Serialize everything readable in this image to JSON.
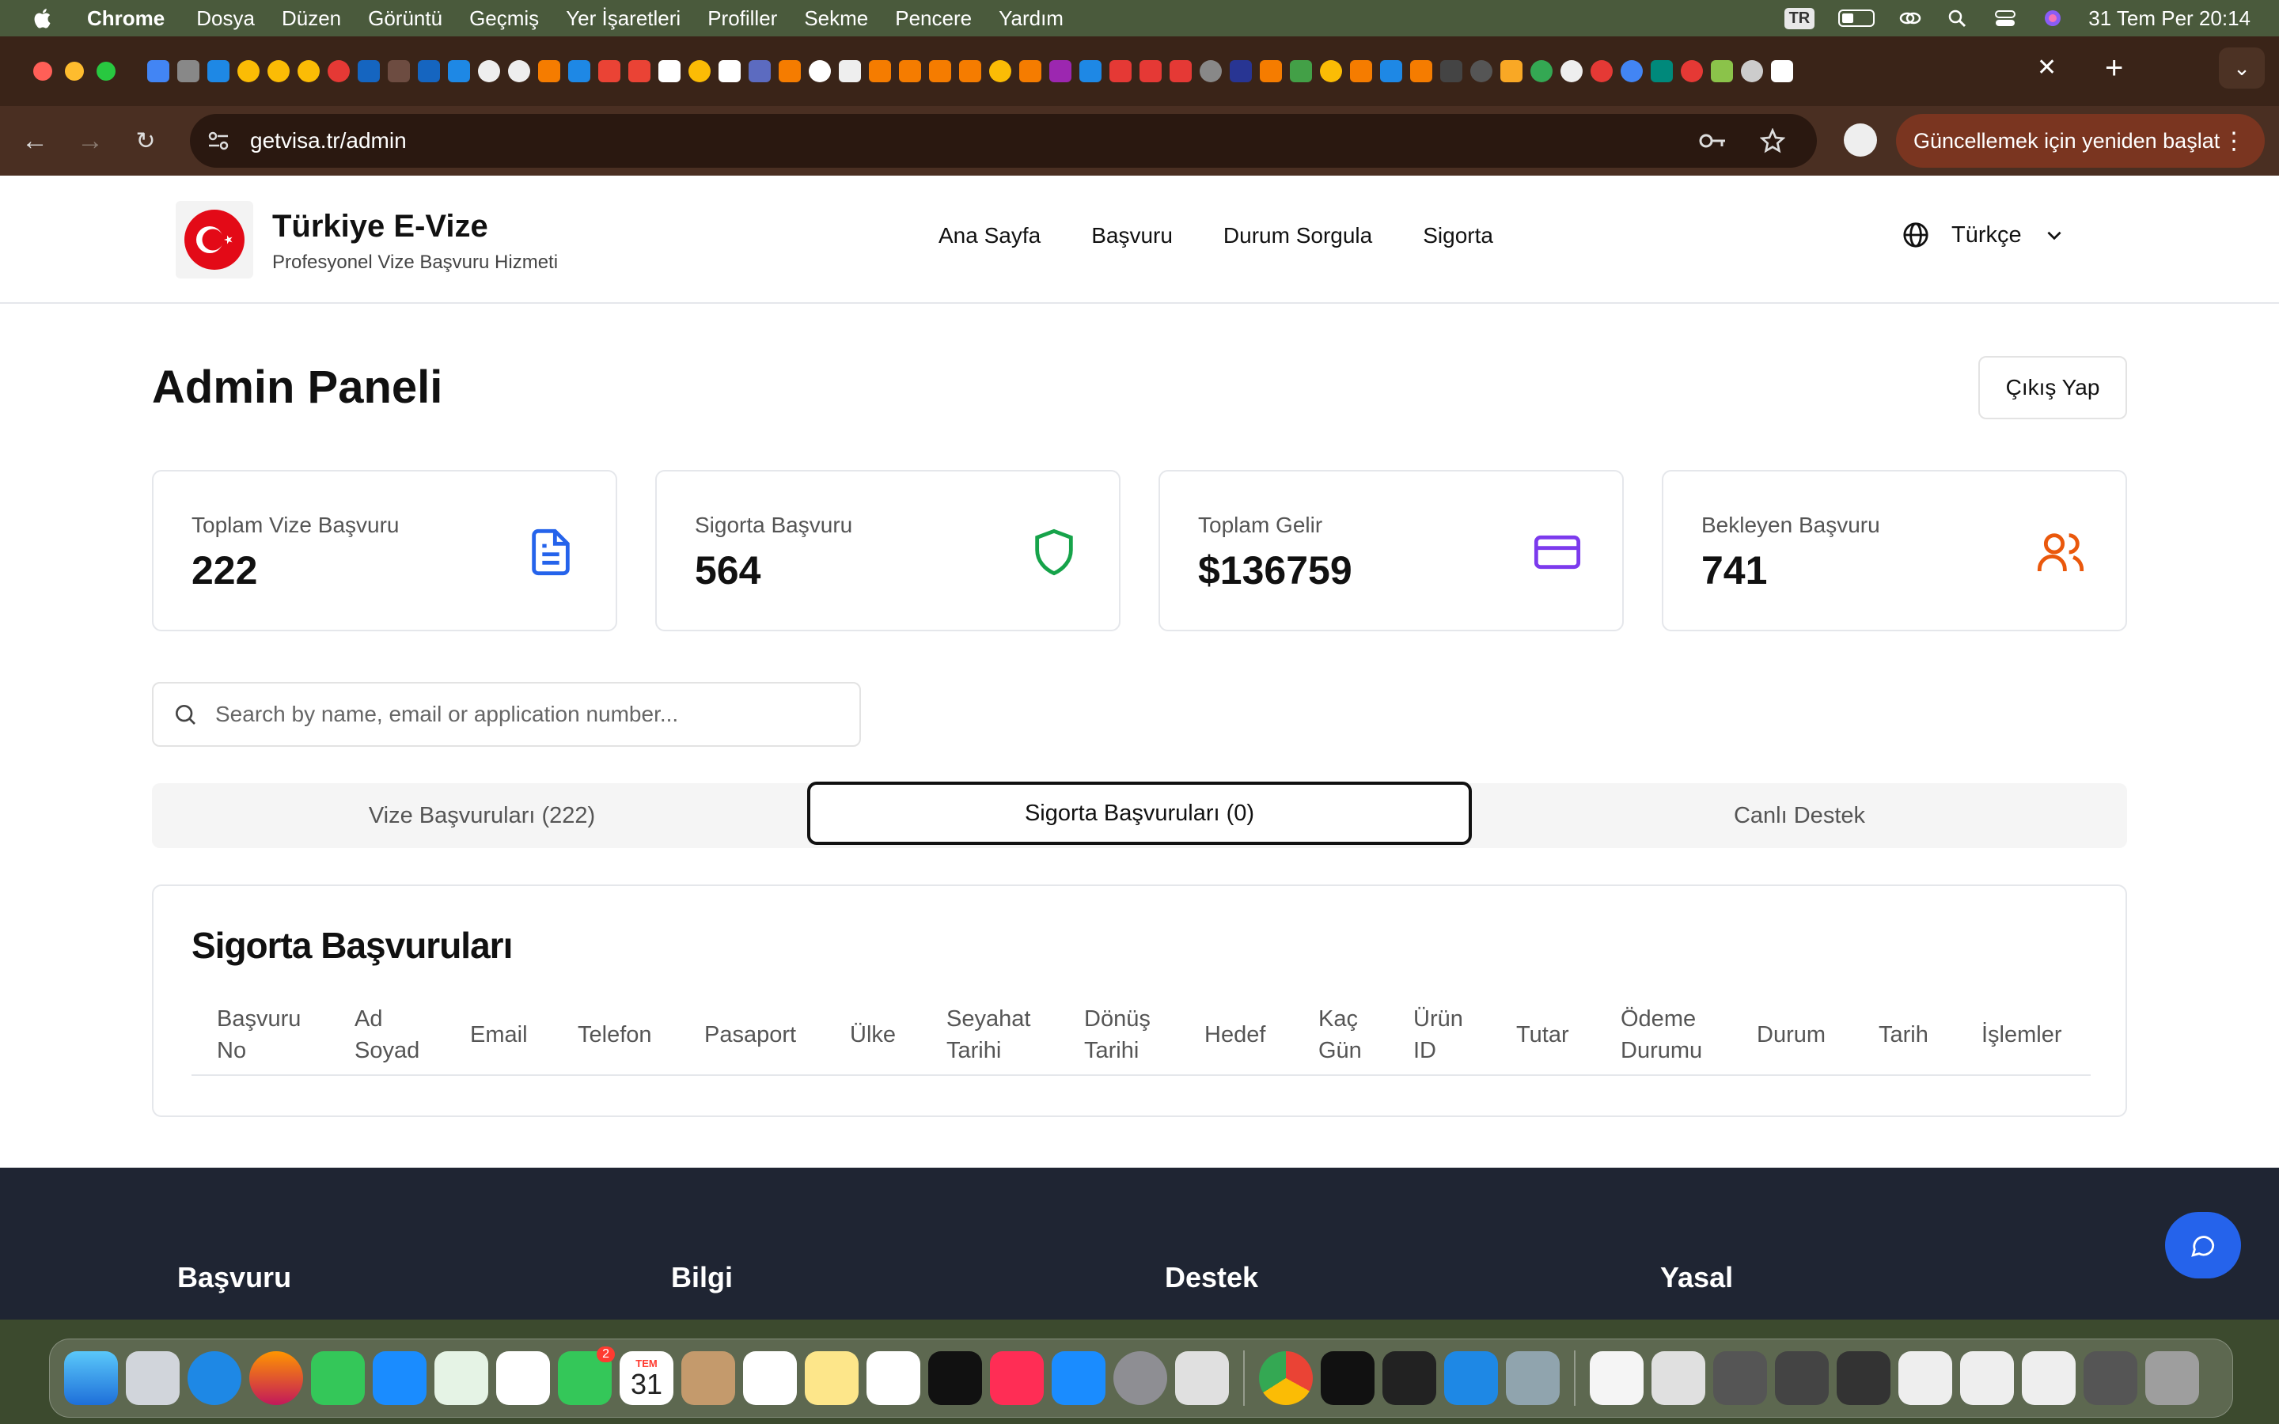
{
  "menubar": {
    "app_name": "Chrome",
    "items": [
      "Dosya",
      "Düzen",
      "Görüntü",
      "Geçmiş",
      "Yer İşaretleri",
      "Profiller",
      "Sekme",
      "Pencere",
      "Yardım"
    ],
    "input_source": "TR",
    "datetime": "31 Tem Per  20:14"
  },
  "browser": {
    "url": "getvisa.tr/admin",
    "update_button": "Güncellemek için yeniden başlat",
    "tab_close": "✕",
    "new_tab": "+"
  },
  "site": {
    "brand_title": "Türkiye E-Vize",
    "brand_subtitle": "Profesyonel Vize Başvuru Hizmeti",
    "nav": [
      "Ana Sayfa",
      "Başvuru",
      "Durum Sorgula",
      "Sigorta"
    ],
    "language": "Türkçe"
  },
  "admin": {
    "title": "Admin Paneli",
    "logout": "Çıkış Yap",
    "stats": [
      {
        "label": "Toplam Vize Başvuru",
        "value": "222",
        "icon": "document-icon",
        "color": "#2563eb"
      },
      {
        "label": "Sigorta Başvuru",
        "value": "564",
        "icon": "shield-icon",
        "color": "#16a34a"
      },
      {
        "label": "Toplam Gelir",
        "value": "$136759",
        "icon": "credit-card-icon",
        "color": "#7c3aed"
      },
      {
        "label": "Bekleyen Başvuru",
        "value": "741",
        "icon": "users-icon",
        "color": "#ea580c"
      }
    ],
    "search_placeholder": "Search by name, email or application number...",
    "tabs": [
      "Vize Başvuruları (222)",
      "Sigorta Başvuruları (0)",
      "Canlı Destek"
    ],
    "active_tab": 1,
    "table": {
      "title": "Sigorta Başvuruları",
      "columns": [
        [
          "Başvuru",
          "No"
        ],
        [
          "Ad",
          "Soyad"
        ],
        [
          "Email"
        ],
        [
          "Telefon"
        ],
        [
          "Pasaport"
        ],
        [
          "Ülke"
        ],
        [
          "Seyahat",
          "Tarihi"
        ],
        [
          "Dönüş",
          "Tarihi"
        ],
        [
          "Hedef"
        ],
        [
          "Kaç",
          "Gün"
        ],
        [
          "Ürün",
          "ID"
        ],
        [
          "Tutar"
        ],
        [
          "Ödeme",
          "Durumu"
        ],
        [
          "Durum"
        ],
        [
          "Tarih"
        ],
        [
          "İşlemler"
        ]
      ],
      "rows": []
    }
  },
  "footer": {
    "headings": [
      "Başvuru",
      "Bilgi",
      "Destek",
      "Yasal"
    ]
  },
  "dock": {
    "calendar_month": "TEM",
    "calendar_day": "31",
    "facetime_badge": "2"
  },
  "colors": {
    "accent_blue": "#2563eb",
    "footer_bg": "#1f2533",
    "flag_red": "#e30a17"
  }
}
